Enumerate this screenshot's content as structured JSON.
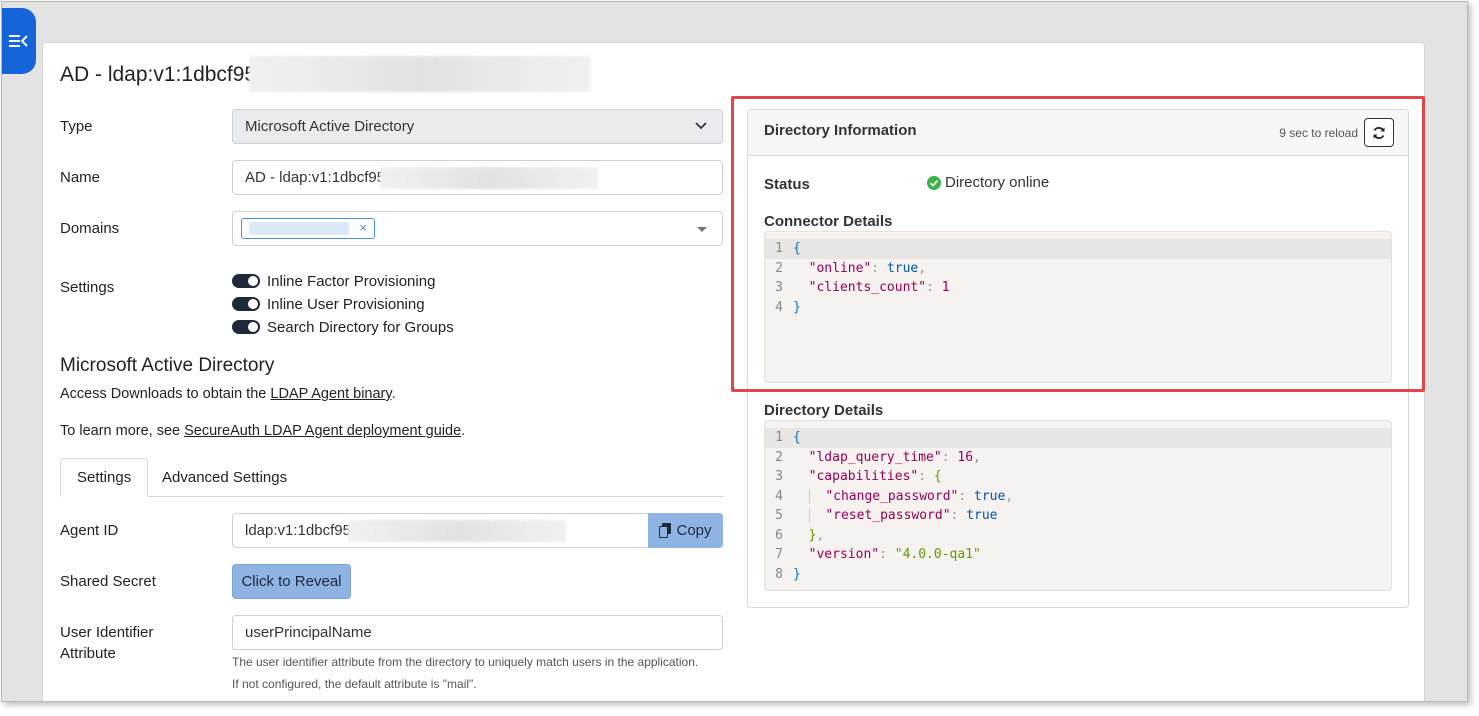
{
  "page": {
    "title": "AD - ldap:v1:1dbcf95"
  },
  "form": {
    "type_label": "Type",
    "type_value": "Microsoft Active Directory",
    "name_label": "Name",
    "name_value": "AD - ldap:v1:1dbcf95",
    "domains_label": "Domains",
    "domains_remove": "×",
    "settings_label": "Settings",
    "toggles": [
      "Inline Factor Provisioning",
      "Inline User Provisioning",
      "Search Directory for Groups"
    ]
  },
  "section": {
    "heading": "Microsoft Active Directory",
    "line1_prefix": "Access Downloads to obtain the ",
    "line1_link": "LDAP Agent binary",
    "line1_suffix": ".",
    "line2_prefix": "To learn more, see ",
    "line2_link": "SecureAuth LDAP Agent deployment guide",
    "line2_suffix": "."
  },
  "tabs": [
    "Settings",
    "Advanced Settings"
  ],
  "settings_tab": {
    "agent_id_label": "Agent ID",
    "agent_id_value": "ldap:v1:1dbcf95",
    "copy_label": "Copy",
    "shared_secret_label": "Shared Secret",
    "reveal_label": "Click to Reveal",
    "user_identifier_label_1": "User Identifier",
    "user_identifier_label_2": "Attribute",
    "user_identifier_value": "userPrincipalName",
    "user_identifier_help": "The user identifier attribute from the directory to uniquely match users in the application. If not configured, the default attribute is \"mail\"."
  },
  "directory_panel": {
    "title": "Directory Information",
    "reload_text": "9 sec to reload",
    "status_label": "Status",
    "status_value": "Directory online",
    "connector_label": "Connector Details",
    "directory_details_label": "Directory Details"
  },
  "connector_code": {
    "online_key": "\"online\"",
    "online_val": "true",
    "clients_key": "\"clients_count\"",
    "clients_val": "1"
  },
  "directory_code": {
    "ldap_key": "\"ldap_query_time\"",
    "ldap_val": "16",
    "cap_key": "\"capabilities\"",
    "cp_key": "\"change_password\"",
    "cp_val": "true",
    "rp_key": "\"reset_password\"",
    "rp_val": "true",
    "ver_key": "\"version\"",
    "ver_val": "\"4.0.0-qa1\""
  },
  "colors": {
    "accent": "#1565d8",
    "button": "#8fb4e3",
    "status_ok": "#3cb34a",
    "highlight_box": "#e0474c"
  }
}
